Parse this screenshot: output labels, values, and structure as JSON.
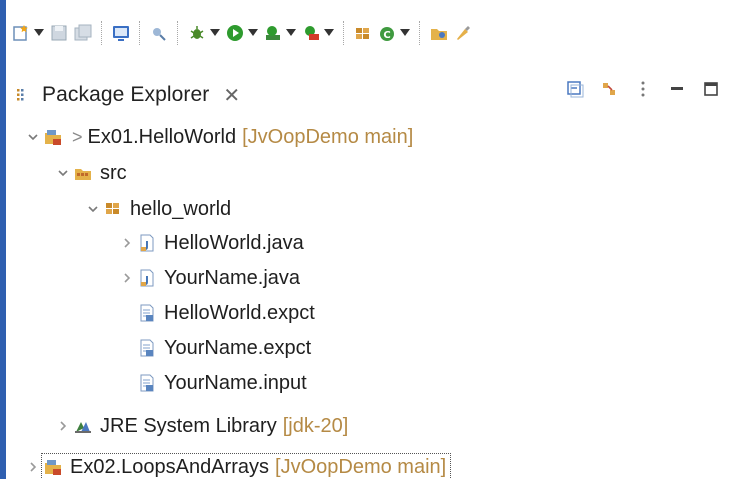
{
  "view": {
    "title": "Package Explorer",
    "close_glyph": "✕"
  },
  "toolbar": {
    "icons": [
      "new-wizard-icon",
      "save-icon",
      "save-all-icon",
      "open-console-icon",
      "skip-breakpoints-icon",
      "debug-icon",
      "run-icon",
      "run-coverage-icon",
      "external-tools-icon",
      "new-java-package-icon",
      "new-java-class-icon",
      "open-type-icon",
      "search-icon"
    ]
  },
  "tree": {
    "project1": {
      "name": "Ex01.HelloWorld",
      "decoration": "[JvOopDemo main]",
      "git_prefix": ">"
    },
    "src": {
      "name": "src"
    },
    "package": {
      "name": "hello_world"
    },
    "file1": {
      "name": "HelloWorld.java"
    },
    "file2": {
      "name": "YourName.java"
    },
    "file3": {
      "name": "HelloWorld.expct"
    },
    "file4": {
      "name": "YourName.expct"
    },
    "file5": {
      "name": "YourName.input"
    },
    "jre": {
      "name": "JRE System Library",
      "decoration": "[jdk-20]"
    },
    "project2": {
      "name": "Ex02.LoopsAndArrays",
      "decoration": "[JvOopDemo main]"
    }
  },
  "colors": {
    "accent": "#2f5fb0",
    "decoration": "#b58a45",
    "twisty": "#7a7a7a"
  }
}
